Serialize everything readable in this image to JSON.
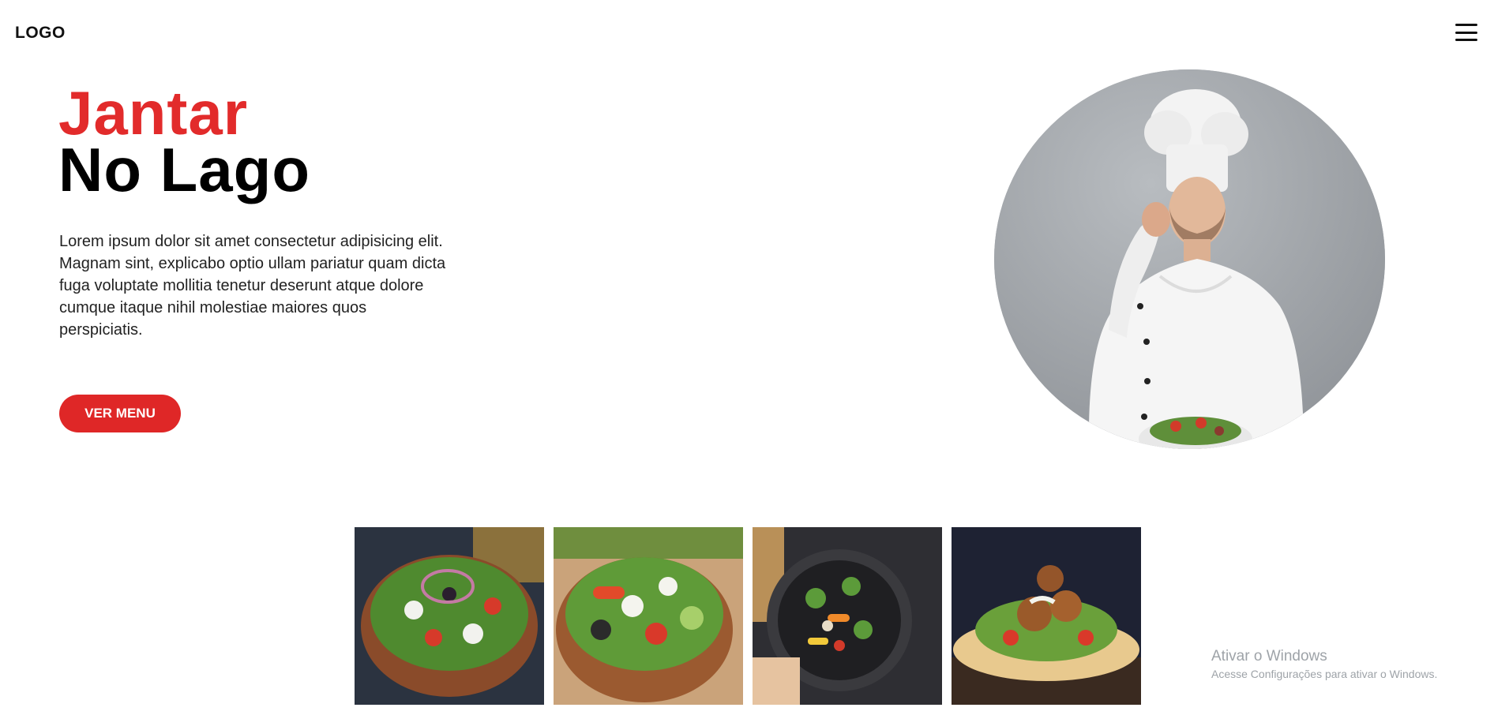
{
  "header": {
    "logo": "LOGO",
    "menu_icon": "hamburger-menu-icon"
  },
  "hero": {
    "title_line1": "Jantar",
    "title_line2": "No Lago",
    "description": "Lorem ipsum dolor sit amet consectetur adipisicing elit. Magnam sint, explicabo optio ullam pariatur quam dicta fuga voluptate mollitia tenetur deserunt atque dolore cumque itaque nihil molestiae maiores quos perspiciatis.",
    "button_label": "VER MENU",
    "image": "chef-photo"
  },
  "gallery": {
    "images": [
      "greek-salad-photo",
      "caprese-salad-photo",
      "vegetable-pan-photo",
      "falafel-wrap-photo"
    ]
  },
  "watermark": {
    "title": "Ativar o Windows",
    "subtitle": "Acesse Configurações para ativar o Windows."
  },
  "colors": {
    "accent": "#df2727",
    "text": "#111111",
    "background": "#ffffff"
  }
}
